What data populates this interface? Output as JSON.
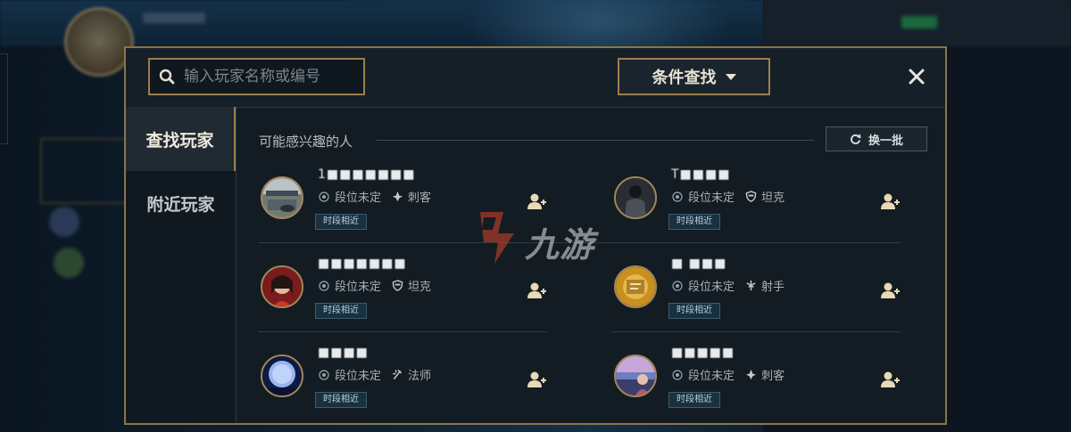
{
  "search": {
    "placeholder": "输入玩家名称或编号"
  },
  "filter": {
    "label": "条件查找"
  },
  "sidebar": {
    "tabs": [
      {
        "label": "查找玩家"
      },
      {
        "label": "附近玩家"
      }
    ]
  },
  "section": {
    "title": "可能感兴趣的人"
  },
  "refresh": {
    "label": "换一批"
  },
  "players": [
    {
      "name": "1■■■■■■■",
      "rank": "段位未定",
      "role": "刺客",
      "role_icon": "assassin-icon",
      "tag": "时段相近"
    },
    {
      "name": "T■■■■",
      "rank": "段位未定",
      "role": "坦克",
      "role_icon": "tank-icon",
      "tag": "时段相近"
    },
    {
      "name": "■■■■■■■",
      "rank": "段位未定",
      "role": "坦克",
      "role_icon": "tank-icon",
      "tag": "时段相近"
    },
    {
      "name": "■ ■■■",
      "rank": "段位未定",
      "role": "射手",
      "role_icon": "marksman-icon",
      "tag": "时段相近"
    },
    {
      "name": "■■■■",
      "rank": "段位未定",
      "role": "法师",
      "role_icon": "mage-icon",
      "tag": "时段相近"
    },
    {
      "name": "■■■■■",
      "rank": "段位未定",
      "role": "刺客",
      "role_icon": "assassin-icon",
      "tag": "时段相近"
    }
  ],
  "watermark": {
    "text": "九游"
  },
  "colors": {
    "gold_border": "#9a7f4d",
    "panel_bg": "#131c23",
    "tag_bg": "#18303f",
    "watermark_red": "#d9442c"
  }
}
